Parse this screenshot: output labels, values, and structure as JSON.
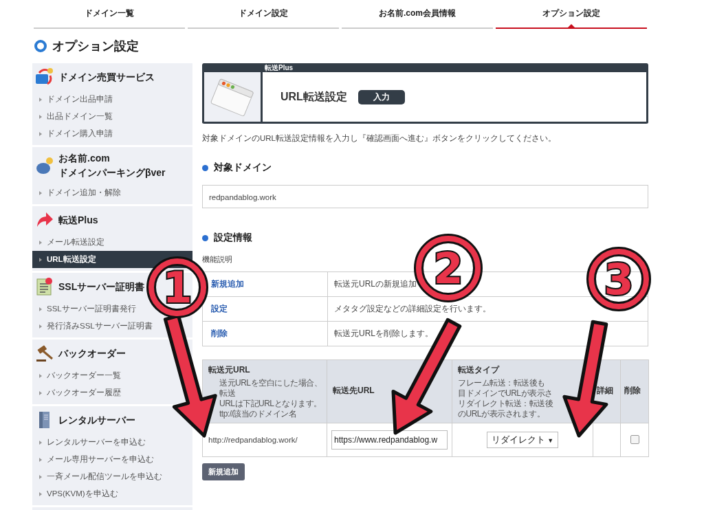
{
  "tabs": [
    {
      "label": "ドメイン一覧",
      "selected": false
    },
    {
      "label": "ドメイン設定",
      "selected": false
    },
    {
      "label": "お名前.com会員情報",
      "selected": false
    },
    {
      "label": "オプション設定",
      "selected": true
    }
  ],
  "page_title": "オプション設定",
  "sidebar": {
    "sections": [
      {
        "kind": "sale",
        "title_lines": [
          "ドメイン売買サービス"
        ],
        "items": [
          {
            "label": "ドメイン出品申請",
            "selected": false
          },
          {
            "label": "出品ドメイン一覧",
            "selected": false
          },
          {
            "label": "ドメイン購入申請",
            "selected": false
          }
        ]
      },
      {
        "kind": "parking",
        "title_lines": [
          "お名前.com",
          "ドメインパーキングβver"
        ],
        "items": [
          {
            "label": "ドメイン追加・解除",
            "selected": false
          }
        ]
      },
      {
        "kind": "forward",
        "title_lines": [
          "転送Plus"
        ],
        "items": [
          {
            "label": "メール転送設定",
            "selected": false
          },
          {
            "label": "URL転送設定",
            "selected": true
          }
        ]
      },
      {
        "kind": "ssl",
        "title_lines": [
          "SSLサーバー証明書"
        ],
        "items": [
          {
            "label": "SSLサーバー証明書発行",
            "selected": false
          },
          {
            "label": "発行済みSSLサーバー証明書",
            "selected": false
          }
        ]
      },
      {
        "kind": "backorder",
        "title_lines": [
          "バックオーダー"
        ],
        "items": [
          {
            "label": "バックオーダー一覧",
            "selected": false
          },
          {
            "label": "バックオーダー履歴",
            "selected": false
          }
        ]
      },
      {
        "kind": "server",
        "title_lines": [
          "レンタルサーバー"
        ],
        "items": [
          {
            "label": "レンタルサーバーを申込む",
            "selected": false
          },
          {
            "label": "メール専用サーバーを申込む",
            "selected": false
          },
          {
            "label": "一斉メール配信ツールを申込む",
            "selected": false
          },
          {
            "label": "VPS(KVM)を申込む",
            "selected": false
          }
        ]
      }
    ]
  },
  "panel": {
    "category": "転送Plus",
    "title": "URL転送設定",
    "badge": "入力"
  },
  "instruction": "対象ドメインのURL転送設定情報を入力し『確認画面へ進む』ボタンをクリックしてください。",
  "target_domain": {
    "heading": "対象ドメイン",
    "value": "redpandablog.work"
  },
  "settings": {
    "heading": "設定情報",
    "caption": "機能説明",
    "functions": [
      {
        "name": "新規追加",
        "description": "転送元URLの新規追加"
      },
      {
        "name": "設定",
        "description": "メタタグ設定などの詳細設定を行います。"
      },
      {
        "name": "削除",
        "description": "転送元URLを削除します。"
      }
    ],
    "columns": [
      {
        "title": "転送元URL",
        "note_lines": [
          "送元URLを空白にした場合、転送",
          "URLは下記URLとなります。",
          "ttp://該当のドメイン名"
        ]
      },
      {
        "title": "転送先URL"
      },
      {
        "title": "転送タイプ",
        "note_lines": [
          "フレーム転送：転送後も",
          "目ドメインでURLが表示さ",
          "リダイレクト転送：転送後",
          "のURLが表示されます。"
        ]
      },
      {
        "title": "詳細"
      },
      {
        "title": "削除"
      }
    ],
    "rows": [
      {
        "source": "http://redpandablog.work/",
        "destination": "https://www.redpandablog.w",
        "type": "リダイレクト",
        "caret": "▼",
        "delete_checked": false
      }
    ],
    "add_button": "新規追加"
  },
  "annotations": [
    {
      "label": "1"
    },
    {
      "label": "2"
    },
    {
      "label": "3"
    }
  ]
}
